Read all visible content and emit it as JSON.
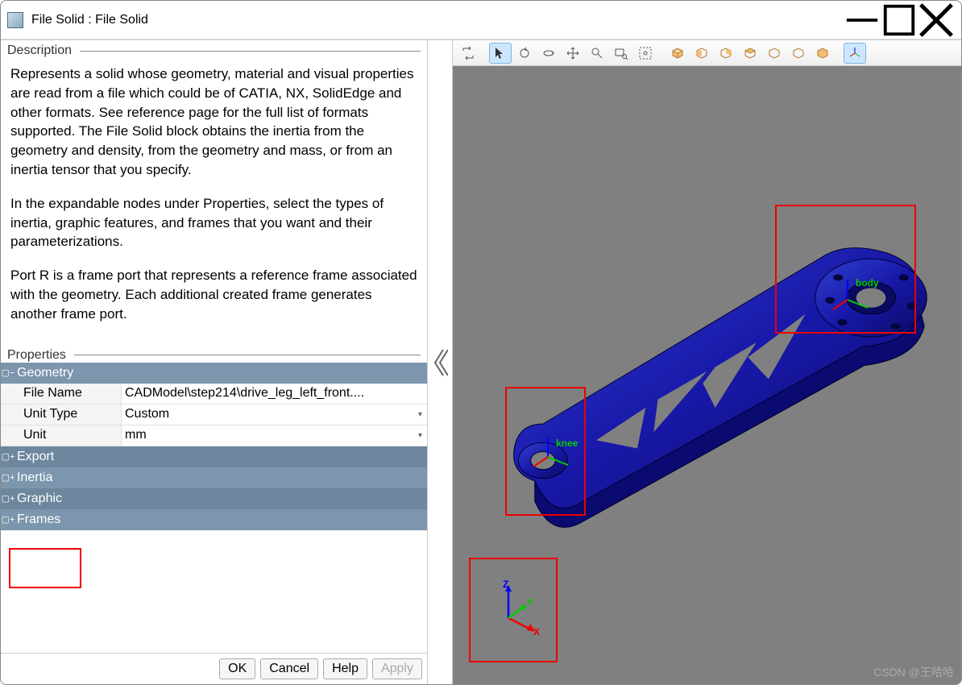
{
  "window": {
    "title": "File Solid : File Solid"
  },
  "sections": {
    "description_label": "Description",
    "properties_label": "Properties"
  },
  "description": {
    "p1": "Represents a solid whose geometry, material and visual properties are read from a file which could be of CATIA, NX, SolidEdge and other formats. See reference page for the full list of formats supported. The File Solid block obtains the inertia from the geometry and density, from the geometry and mass, or from an inertia tensor that you specify.",
    "p2": "In the expandable nodes under Properties, select the types of inertia, graphic features, and frames that you want and their parameterizations.",
    "p3": "Port R is a frame port that represents a reference frame associated with the geometry. Each additional created frame generates another frame port."
  },
  "properties": {
    "geometry": {
      "label": "Geometry",
      "expanded": true,
      "file_name_label": "File Name",
      "file_name_value": "CADModel\\step214\\drive_leg_left_front....",
      "unit_type_label": "Unit Type",
      "unit_type_value": "Custom",
      "unit_label": "Unit",
      "unit_value": "mm"
    },
    "export": {
      "label": "Export",
      "expanded": false
    },
    "inertia": {
      "label": "Inertia",
      "expanded": false
    },
    "graphic": {
      "label": "Graphic",
      "expanded": false
    },
    "frames": {
      "label": "Frames",
      "expanded": false
    }
  },
  "buttons": {
    "ok": "OK",
    "cancel": "Cancel",
    "help": "Help",
    "apply": "Apply"
  },
  "viewport": {
    "frame_labels": {
      "body": "body",
      "knee": "knee"
    },
    "axis_letters": {
      "x": "X",
      "y": "Y",
      "z": "Z"
    }
  },
  "watermark": "CSDN @王哈哈"
}
